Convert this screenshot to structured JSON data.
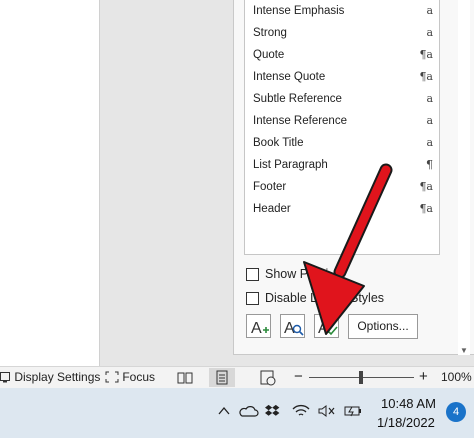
{
  "styles_pane": {
    "items": [
      {
        "label": "Intense Emphasis",
        "marker": "a"
      },
      {
        "label": "Strong",
        "marker": "a"
      },
      {
        "label": "Quote",
        "marker": "¶a"
      },
      {
        "label": "Intense Quote",
        "marker": "¶a"
      },
      {
        "label": "Subtle Reference",
        "marker": "a"
      },
      {
        "label": "Intense Reference",
        "marker": "a"
      },
      {
        "label": "Book Title",
        "marker": "a"
      },
      {
        "label": "List Paragraph",
        "marker": "¶"
      },
      {
        "label": "Footer",
        "marker": "¶a"
      },
      {
        "label": "Header",
        "marker": "¶a"
      }
    ],
    "show_preview_label": "Show Previ",
    "disable_linked_label": "Disable Lin",
    "disable_linked_label_tail": "Styles",
    "options_label": "Options..."
  },
  "statusbar": {
    "display_settings_label": "Display Settings",
    "focus_label": "Focus",
    "zoom_level": "100%",
    "zoom_minus": "−",
    "zoom_plus": "+"
  },
  "taskbar": {
    "time": "10:48 AM",
    "date": "1/18/2022",
    "notification_count": "4"
  },
  "colors": {
    "annotation_arrow": "#e0141c",
    "notification_badge": "#1a73c9"
  }
}
